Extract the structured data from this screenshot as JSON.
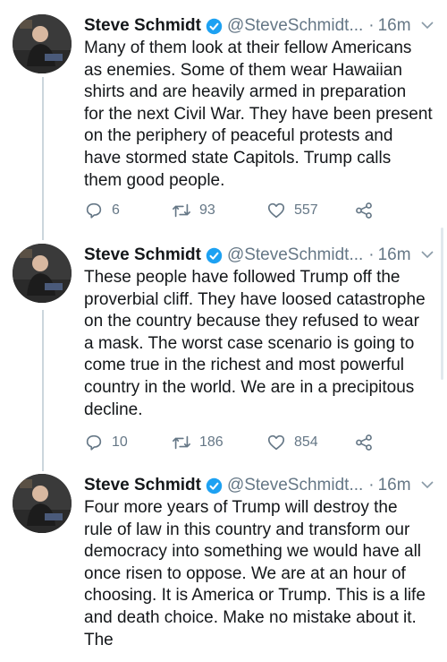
{
  "author": {
    "name": "Steve Schmidt",
    "handle": "@SteveSchmidt...",
    "separator": "·",
    "time": "16m"
  },
  "icons": {
    "verified": "verified-badge-icon",
    "caret": "chevron-down-icon",
    "reply": "reply-icon",
    "retweet": "retweet-icon",
    "like": "heart-icon",
    "share": "share-icon"
  },
  "colors": {
    "verified": "#1da1f2",
    "muted": "#657786",
    "text": "#14171a"
  },
  "tweets": [
    {
      "lines": [
        "Many of them look at their fellow Americans",
        "as enemies. Some of them wear Hawaiian",
        "shirts and are heavily armed in preparation",
        "for the next Civil War. They have been present",
        "on the periphery of peaceful protests and",
        "have stormed state Capitols. Trump calls",
        "them good people."
      ],
      "replies": "6",
      "retweets": "93",
      "likes": "557"
    },
    {
      "lines": [
        "These people have followed Trump off the",
        "proverbial cliff. They have loosed catastrophe",
        "on the country because they refused to wear",
        "a mask.  The worst case scenario is going to",
        "come true in the richest and most powerful",
        "country in the world. We are in a precipitous",
        "decline."
      ],
      "replies": "10",
      "retweets": "186",
      "likes": "854"
    },
    {
      "lines": [
        "Four more years of Trump will destroy the",
        "rule of law in this country and transform our",
        "democracy into something we would have all",
        "once risen to oppose. We are at an hour of",
        "choosing. It is America or Trump. This is a life",
        "and death choice. Make no mistake about it.",
        "The"
      ]
    }
  ]
}
